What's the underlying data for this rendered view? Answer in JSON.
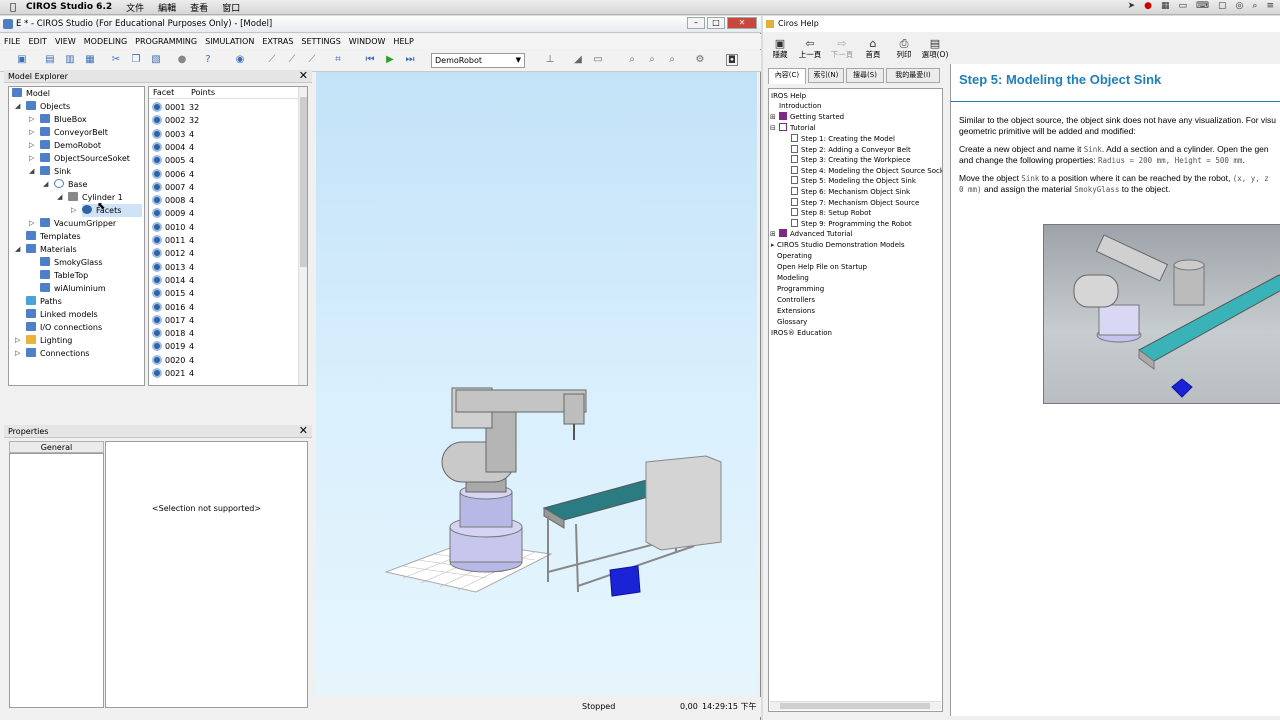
{
  "macbar": {
    "app": "CIROS Studio 6.2",
    "menus": [
      "文件",
      "編輯",
      "查看",
      "窗口"
    ]
  },
  "ciros": {
    "title": "E * - CIROS Studio (For Educational Purposes Only) - [Model]",
    "menu": [
      "FILE",
      "EDIT",
      "VIEW",
      "MODELING",
      "PROGRAMMING",
      "SIMULATION",
      "EXTRAS",
      "SETTINGS",
      "WINDOW",
      "HELP"
    ],
    "robot_select": "DemoRobot",
    "explorer_title": "Model Explorer",
    "tree": {
      "model": "Model",
      "objects": "Objects",
      "bluebox": "BlueBox",
      "conveyor": "ConveyorBelt",
      "demorobot": "DemoRobot",
      "objsource": "ObjectSourceSoket",
      "sink": "Sink",
      "base": "Base",
      "cylinder": "Cylinder 1",
      "facets": "Facets",
      "vacuum": "VacuumGripper",
      "templates": "Templates",
      "materials": "Materials",
      "smoky": "SmokyGlass",
      "tabletop": "TableTop",
      "alu": "wiAluminium",
      "paths": "Paths",
      "linked": "Linked models",
      "io": "I/O connections",
      "lighting": "Lighting",
      "connections": "Connections"
    },
    "facets": {
      "col_facet": "Facet",
      "col_points": "Points",
      "rows": [
        [
          "0001",
          "32"
        ],
        [
          "0002",
          "32"
        ],
        [
          "0003",
          "4"
        ],
        [
          "0004",
          "4"
        ],
        [
          "0005",
          "4"
        ],
        [
          "0006",
          "4"
        ],
        [
          "0007",
          "4"
        ],
        [
          "0008",
          "4"
        ],
        [
          "0009",
          "4"
        ],
        [
          "0010",
          "4"
        ],
        [
          "0011",
          "4"
        ],
        [
          "0012",
          "4"
        ],
        [
          "0013",
          "4"
        ],
        [
          "0014",
          "4"
        ],
        [
          "0015",
          "4"
        ],
        [
          "0016",
          "4"
        ],
        [
          "0017",
          "4"
        ],
        [
          "0018",
          "4"
        ],
        [
          "0019",
          "4"
        ],
        [
          "0020",
          "4"
        ],
        [
          "0021",
          "4"
        ]
      ]
    },
    "props_title": "Properties",
    "props_tab": "General",
    "props_msg": "<Selection not supported>",
    "status": {
      "state": "Stopped",
      "coord": "0,00",
      "time": "14:29:15 下午"
    }
  },
  "help": {
    "title": "Ciros Help",
    "toolbar": [
      "隱藏",
      "上一頁",
      "下一頁",
      "首頁",
      "列印",
      "選項(O)"
    ],
    "tabs": [
      "內容(C)",
      "索引(N)",
      "搜尋(S)",
      "我的最愛(I)"
    ],
    "toc": {
      "root": "IROS Help",
      "intro": "Introduction",
      "getting": "Getting Started",
      "tutorial": "Tutorial",
      "steps": [
        "Step 1: Creating the Model",
        "Step 2: Adding a Conveyor Belt",
        "Step 3: Creating the Workpiece",
        "Step 4: Modeling the Object Source Socke",
        "Step 5: Modeling the Object Sink",
        "Step 6: Mechanism Object Sink",
        "Step 7: Mechanism Object Source",
        "Step 8: Setup Robot",
        "Step 9: Programming the Robot"
      ],
      "advanced": "Advanced Tutorial",
      "demo": "CIROS Studio Demonstration Models",
      "operating": "Operating",
      "openhelp": "Open Help File on Startup",
      "modeling": "Modeling",
      "programming": "Programming",
      "controllers": "Controllers",
      "extensions": "Extensions",
      "glossary": "Glossary",
      "education": "IROS® Education"
    },
    "content": {
      "heading": "Step 5: Modeling the Object Sink",
      "p1a": "Similar to the object source, the object sink does not have any visualization. For visu",
      "p1b": "geometric primitive will be added and modified:",
      "p2a": "Create a new object and name it ",
      "p2a_code": "Sink",
      "p2a_rest": ". Add a section and a cylinder. Open the gen",
      "p2b": "and change the following properties: ",
      "p2b_code": "Radius = 200 mm, Height = 500 mm",
      "p2b_end": ".",
      "p3a": "Move the object ",
      "p3a_code": "Sink",
      "p3a_rest": " to a position where it can be reached by the robot, ",
      "p3a_code2": "(x, y, z",
      "p3b_code": "0 mm)",
      "p3b_rest": " and assign the material ",
      "p3b_code2": "SmokyGlass",
      "p3b_end": " to the object."
    }
  },
  "colors": {
    "heading": "#1f7fba",
    "accent": "#4f7fc6",
    "toc_book": "#7b2a86"
  }
}
